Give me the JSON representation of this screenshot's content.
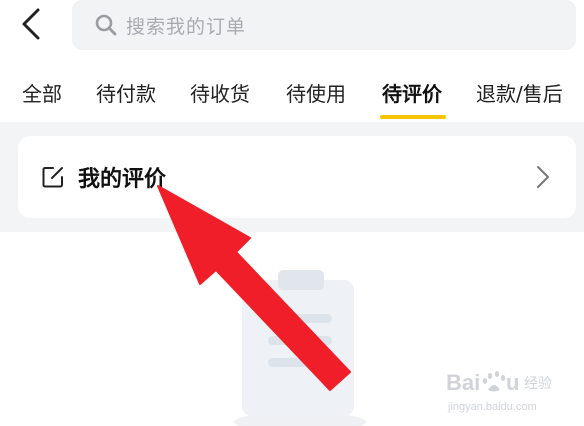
{
  "header": {
    "back_icon": "chevron-left-icon",
    "search": {
      "icon": "search-icon",
      "placeholder": "搜索我的订单"
    }
  },
  "tabs": [
    {
      "label": "全部"
    },
    {
      "label": "待付款"
    },
    {
      "label": "待收货"
    },
    {
      "label": "待使用"
    },
    {
      "label": "待评价",
      "active": true
    },
    {
      "label": "退款/售后"
    }
  ],
  "review_entry": {
    "icon": "edit-icon",
    "label": "我的评价",
    "chevron": "chevron-right-icon"
  },
  "colors": {
    "active_indicator": "#f5c400",
    "content_background": "#f3f4f6",
    "annotation_arrow": "#f01e28"
  },
  "watermark": {
    "brand": "Baidu 经验",
    "url": "jingyan.baidu.com"
  }
}
